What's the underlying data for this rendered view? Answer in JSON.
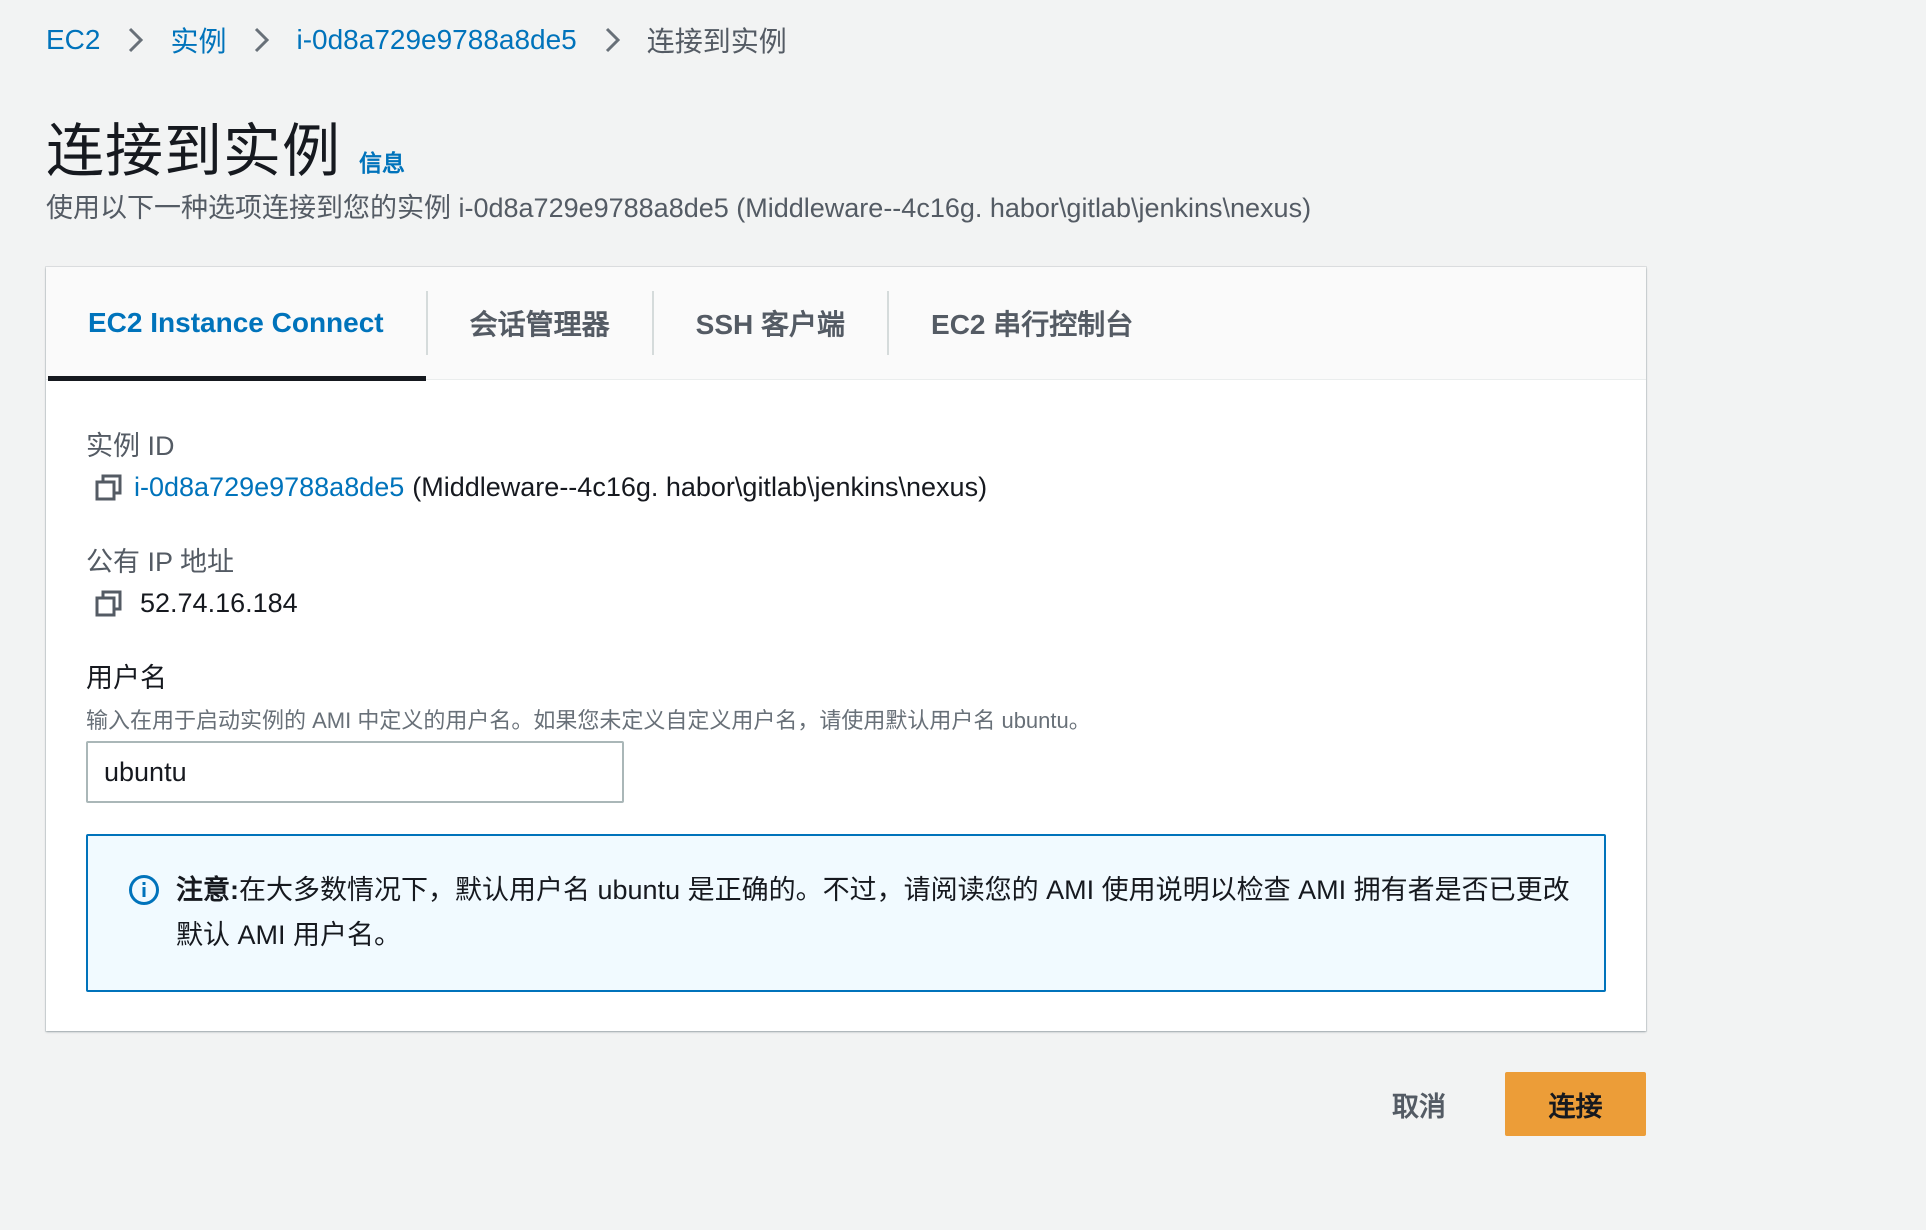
{
  "breadcrumb": {
    "items": [
      "EC2",
      "实例",
      "i-0d8a729e9788a8de5"
    ],
    "current": "连接到实例"
  },
  "header": {
    "title": "连接到实例",
    "info_link": "信息",
    "description": "使用以下一种选项连接到您的实例 i-0d8a729e9788a8de5 (Middleware--4c16g. habor\\gitlab\\jenkins\\nexus)"
  },
  "tabs": [
    {
      "label": "EC2 Instance Connect",
      "active": true
    },
    {
      "label": "会话管理器",
      "active": false
    },
    {
      "label": "SSH 客户端",
      "active": false
    },
    {
      "label": "EC2 串行控制台",
      "active": false
    }
  ],
  "instance": {
    "label": "实例 ID",
    "id": "i-0d8a729e9788a8de5",
    "name_suffix": "(Middleware--4c16g. habor\\gitlab\\jenkins\\nexus)"
  },
  "public_ip": {
    "label": "公有 IP 地址",
    "value": "52.74.16.184"
  },
  "username": {
    "label": "用户名",
    "description": "输入在用于启动实例的 AMI 中定义的用户名。如果您未定义自定义用户名，请使用默认用户名 ubuntu。",
    "value": "ubuntu"
  },
  "alert": {
    "prefix": "注意:",
    "text": "在大多数情况下，默认用户名 ubuntu 是正确的。不过，请阅读您的 AMI 使用说明以检查 AMI 拥有者是否已更改默认 AMI 用户名。"
  },
  "actions": {
    "cancel": "取消",
    "connect": "连接"
  },
  "colors": {
    "link": "#0073bb",
    "primary_button": "#ec9d38",
    "alert_border": "#0073bb",
    "alert_background": "#f1faff",
    "page_background": "#f2f3f3"
  }
}
